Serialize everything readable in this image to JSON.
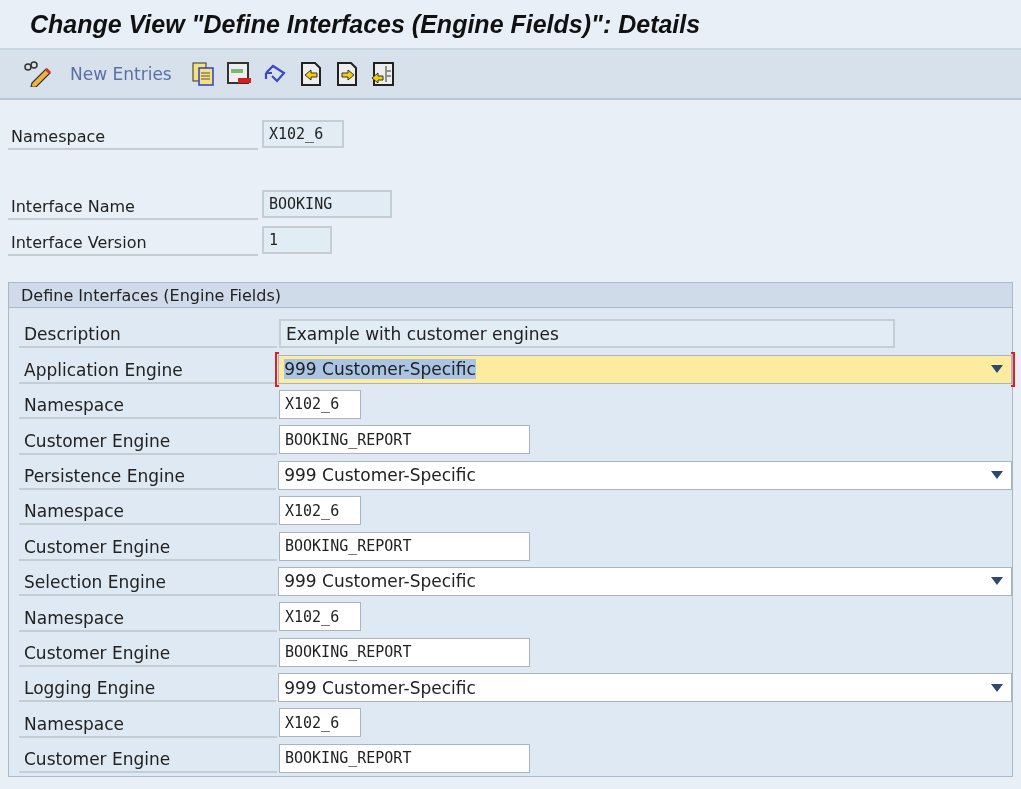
{
  "window": {
    "title": "Change View \"Define Interfaces (Engine Fields)\": Details"
  },
  "toolbar": {
    "items": [
      {
        "kind": "pencil"
      },
      {
        "kind": "button",
        "label": "New Entries"
      },
      {
        "kind": "copy"
      },
      {
        "kind": "delete"
      },
      {
        "kind": "undo"
      },
      {
        "kind": "previous"
      },
      {
        "kind": "next"
      },
      {
        "kind": "other"
      }
    ]
  },
  "header_sections": [
    {
      "fields": [
        {
          "label": "Namespace",
          "value": "X102_6",
          "kind": "short"
        }
      ]
    },
    {
      "fields": [
        {
          "label": "Interface Name",
          "value": "BOOKING",
          "kind": "medium"
        },
        {
          "label": "Interface Version",
          "value": "1",
          "kind": "tiny"
        }
      ]
    }
  ],
  "group": {
    "title": "Define Interfaces (Engine Fields)",
    "rows": [
      {
        "label": "Description",
        "value": "Example with customer engines",
        "kind": "display"
      },
      {
        "label": "Application Engine",
        "value": "999 Customer-Specific",
        "kind": "dropdown",
        "focused": true
      },
      {
        "label": "Namespace",
        "value": "X102_6",
        "kind": "short-input"
      },
      {
        "label": "Customer Engine",
        "value": "BOOKING_REPORT",
        "kind": "long-input"
      },
      {
        "label": "Persistence Engine",
        "value": "999 Customer-Specific",
        "kind": "dropdown",
        "focused": false
      },
      {
        "label": "Namespace",
        "value": "X102_6",
        "kind": "short-input"
      },
      {
        "label": "Customer Engine",
        "value": "BOOKING_REPORT",
        "kind": "long-input"
      },
      {
        "label": "Selection Engine",
        "value": "999 Customer-Specific",
        "kind": "dropdown",
        "focused": false
      },
      {
        "label": "Namespace",
        "value": "X102_6",
        "kind": "short-input"
      },
      {
        "label": "Customer Engine",
        "value": "BOOKING_REPORT",
        "kind": "long-input"
      },
      {
        "label": "Logging Engine",
        "value": "999 Customer-Specific",
        "kind": "dropdown",
        "focused": false
      },
      {
        "label": "Namespace",
        "value": "X102_6",
        "kind": "short-input"
      },
      {
        "label": "Customer Engine",
        "value": "BOOKING_REPORT",
        "kind": "long-input"
      }
    ]
  }
}
